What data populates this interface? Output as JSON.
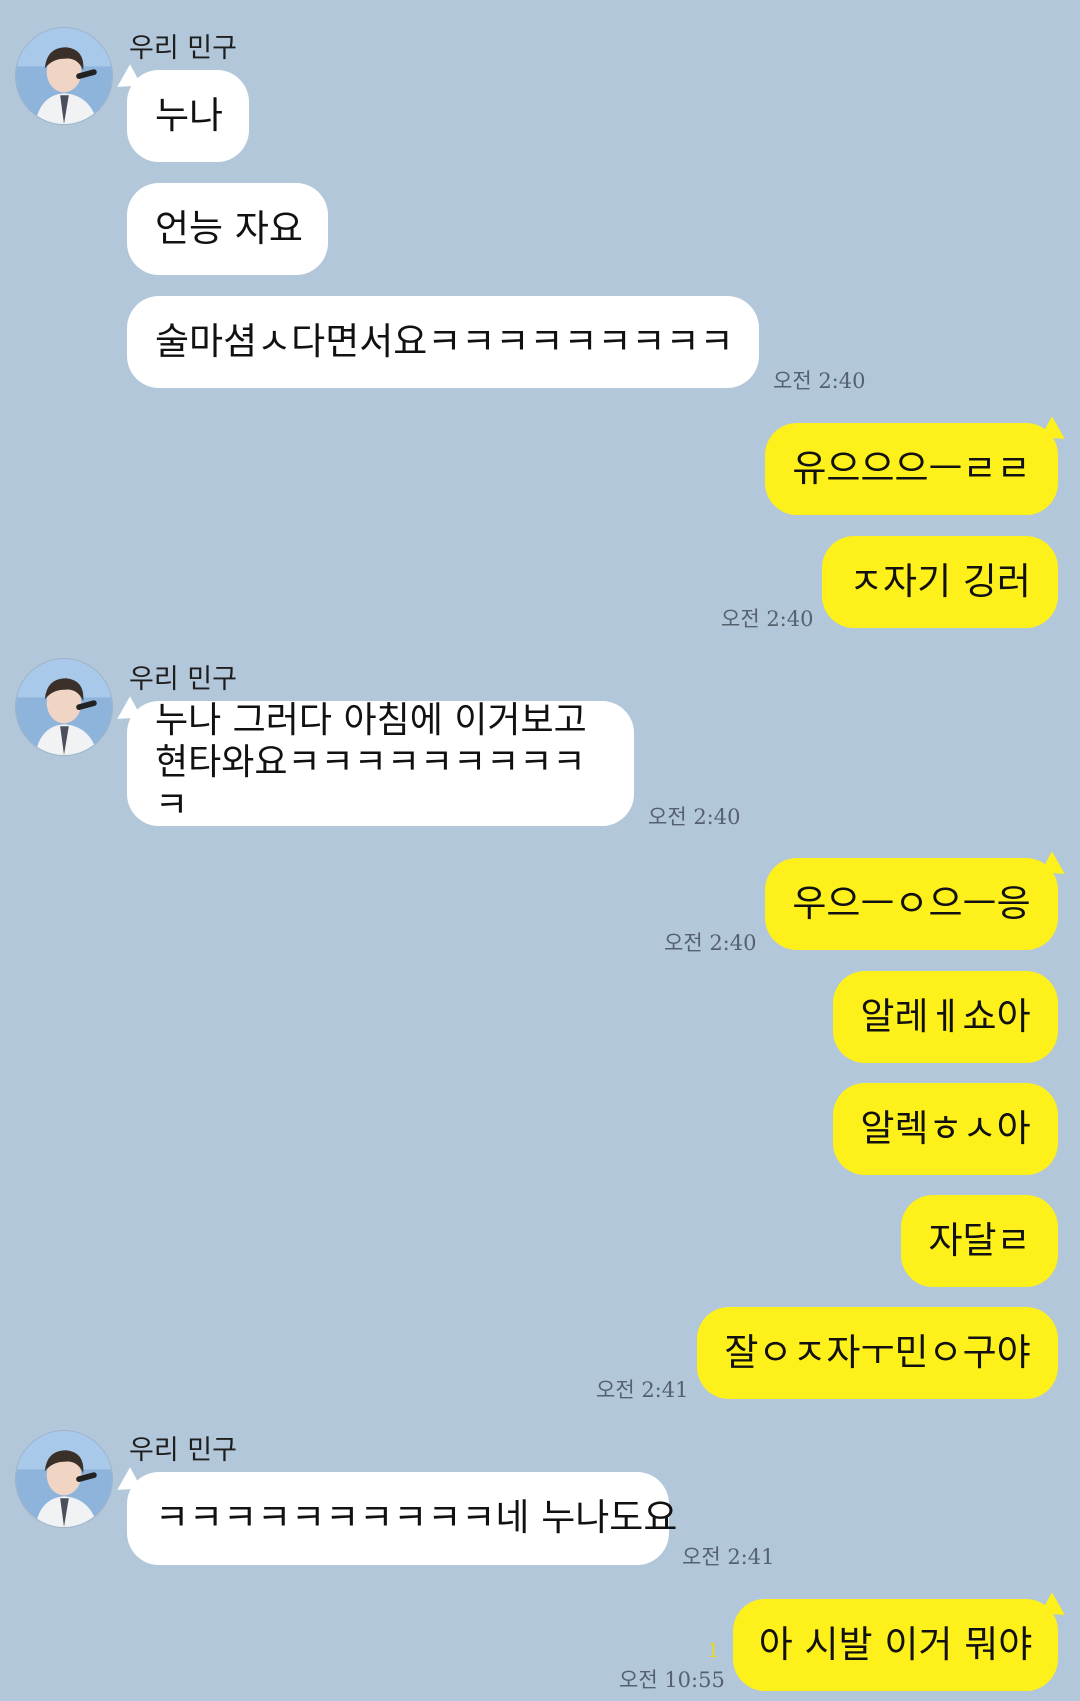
{
  "chat": {
    "sender_name": "우리 민구",
    "messages": [
      {
        "text": "누나"
      },
      {
        "text": "언능 자요"
      },
      {
        "text": "술마셤ㅅ다면서요ㅋㅋㅋㅋㅋㅋㅋㅋㅋ",
        "time": "오전 2:40"
      },
      {
        "text": "유으으으ㅡㄹㄹ"
      },
      {
        "text": "ㅈ자기 깅러",
        "time": "오전 2:40"
      },
      {
        "text": "누나 그러다 아침에 이거보고\n현타와요ㅋㅋㅋㅋㅋㅋㅋㅋㅋㅋ",
        "time": "오전 2:40"
      },
      {
        "text": "우으ㅡㅇ으ㅡ응",
        "time": "오전 2:40"
      },
      {
        "text": "알레ㅔ쇼아"
      },
      {
        "text": "알렉ㅎㅅ아"
      },
      {
        "text": "자달ㄹ"
      },
      {
        "text": "잘ㅇㅈ자ㅜ민ㅇ구야",
        "time": "오전 2:41"
      },
      {
        "text": "ㅋㅋㅋㅋㅋㅋㅋㅋㅋㅋ네 누나도요",
        "time": "오전 2:41"
      },
      {
        "text": "아 시발 이거 뭐야",
        "time": "오전 10:55",
        "unread": "1"
      }
    ]
  },
  "colors": {
    "background": "#b2c7da",
    "incoming_bubble": "#ffffff",
    "outgoing_bubble": "#fef01b"
  },
  "icons": {
    "avatar": "profile-photo-avatar"
  }
}
